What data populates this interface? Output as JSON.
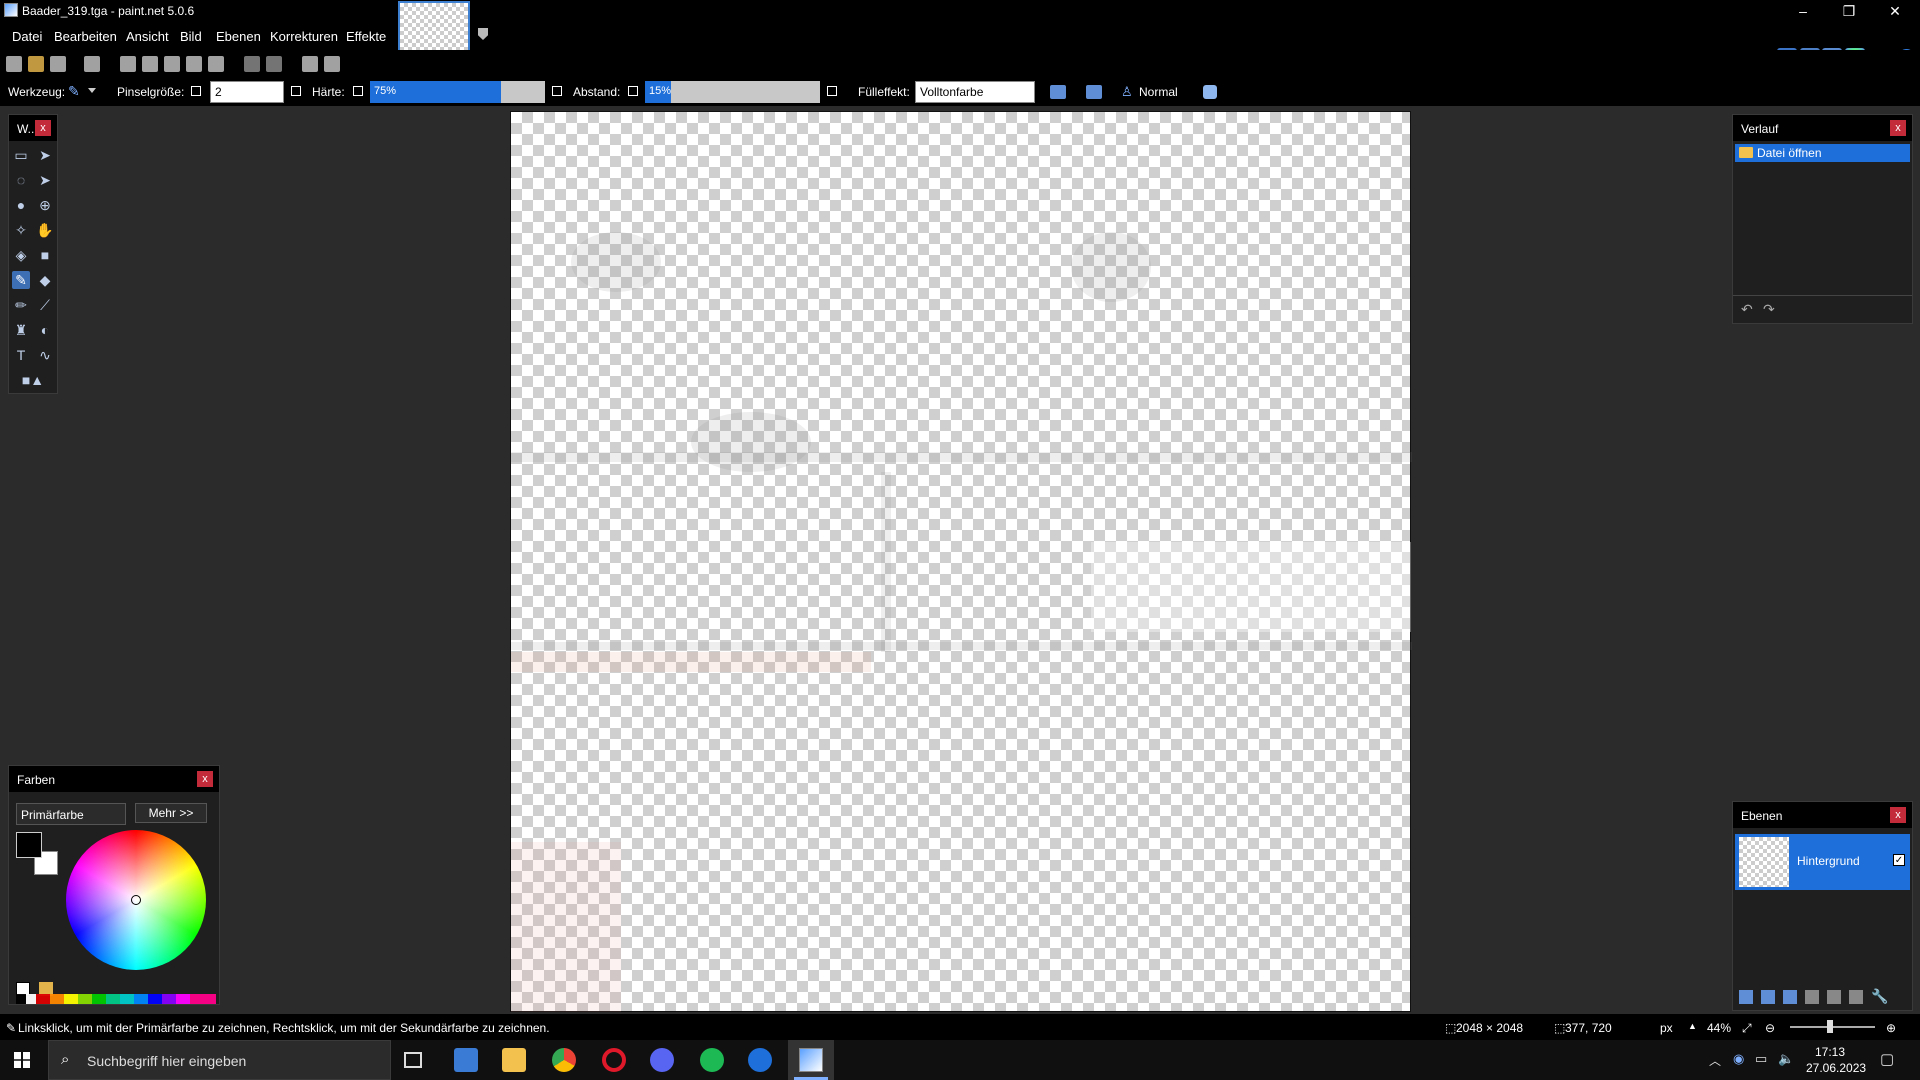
{
  "window": {
    "title": "Baader_319.tga - paint.net 5.0.6",
    "controls": [
      "–",
      "❐",
      "✕"
    ]
  },
  "menu": [
    "Datei",
    "Bearbeiten",
    "Ansicht",
    "Bild",
    "Ebenen",
    "Korrekturen",
    "Effekte"
  ],
  "options_bar": {
    "tool_label": "Werkzeug:",
    "brush_size_label": "Pinselgröße:",
    "brush_size_value": "2",
    "hardness_label": "Härte:",
    "hardness_value": "75%",
    "hardness_fraction": 0.75,
    "spacing_label": "Abstand:",
    "spacing_value": "15%",
    "spacing_fraction": 0.15,
    "fill_label": "Fülleffekt:",
    "fill_value": "Volltonfarbe",
    "blend_mode": "Normal"
  },
  "tools_panel": {
    "title": "W..."
  },
  "history_panel": {
    "title": "Verlauf",
    "entries": [
      "Datei öffnen"
    ]
  },
  "colors_panel": {
    "title": "Farben",
    "mode": "Primärfarbe",
    "more_button": "Mehr >>",
    "primary_color": "#000000",
    "secondary_color": "#ffffff"
  },
  "layers_panel": {
    "title": "Ebenen",
    "layers": [
      {
        "name": "Hintergrund",
        "visible": true
      }
    ]
  },
  "status_bar": {
    "hint": "Linksklick, um mit der Primärfarbe zu zeichnen, Rechtsklick, um mit der Sekundärfarbe zu zeichnen.",
    "image_size": "2048 × 2048",
    "cursor_pos": "377, 720",
    "unit": "px",
    "zoom": "44%",
    "zoom_fraction": 0.44
  },
  "taskbar": {
    "search_placeholder": "Suchbegriff hier eingeben",
    "time": "17:13",
    "date": "27.06.2023"
  },
  "colors": {
    "accent": "#1e6fd9",
    "close": "#c42b3a"
  }
}
